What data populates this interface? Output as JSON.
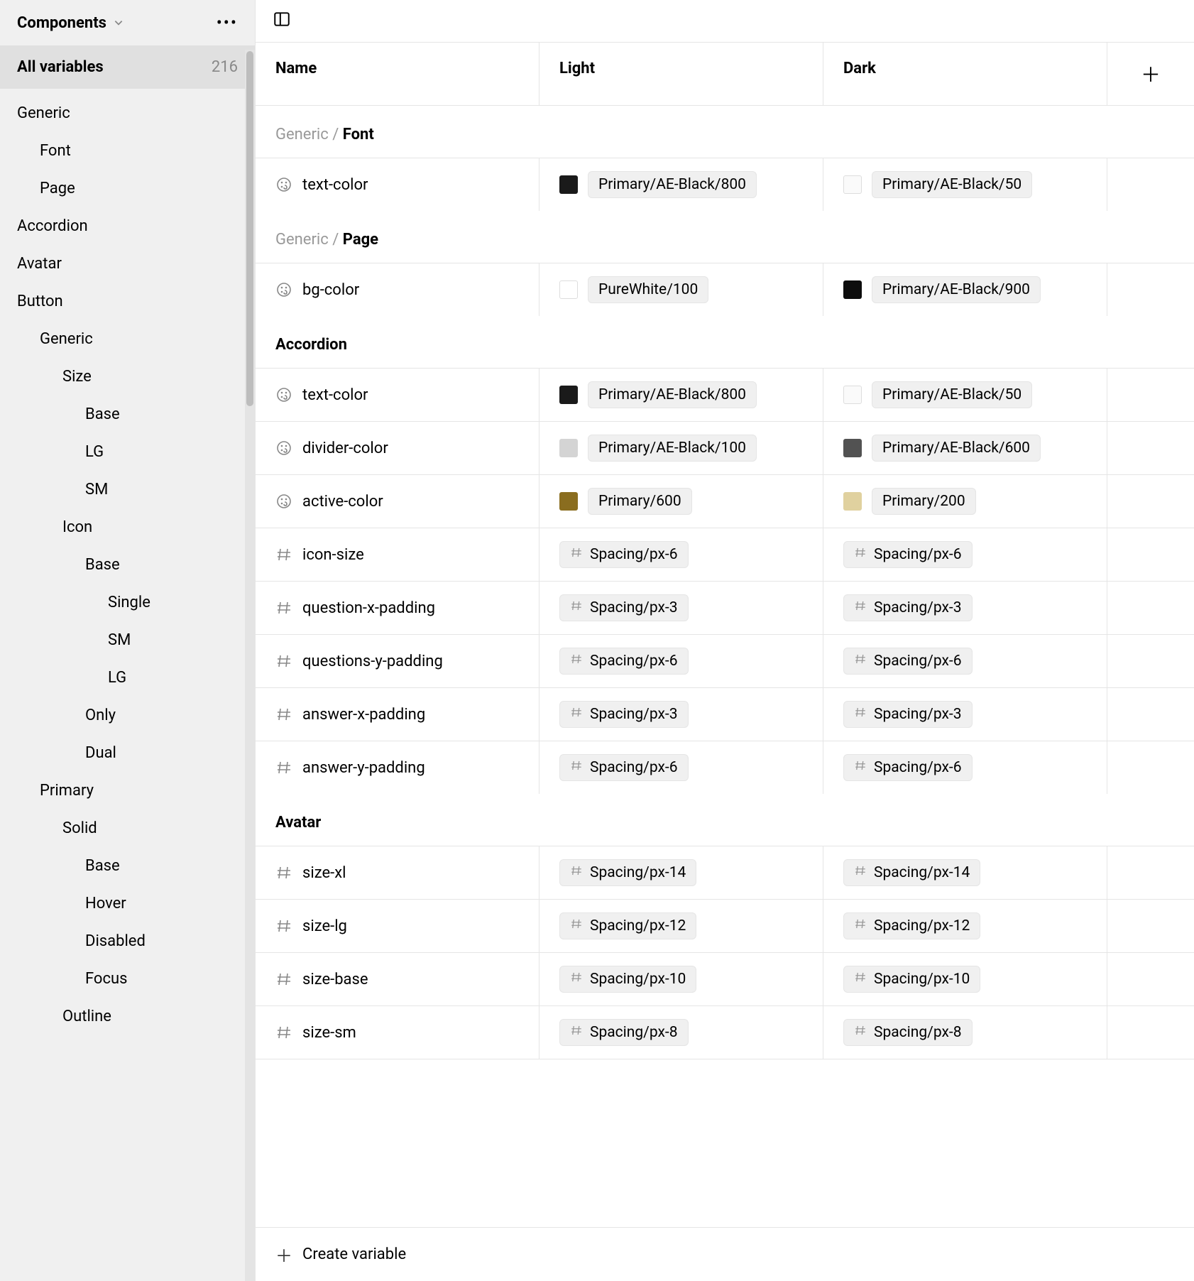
{
  "sidebar": {
    "title": "Components",
    "allVariables": {
      "label": "All variables",
      "count": "216"
    },
    "nav": [
      {
        "label": "Generic",
        "level": 1
      },
      {
        "label": "Font",
        "level": 2
      },
      {
        "label": "Page",
        "level": 2
      },
      {
        "label": "Accordion",
        "level": 1
      },
      {
        "label": "Avatar",
        "level": 1
      },
      {
        "label": "Button",
        "level": 1
      },
      {
        "label": "Generic",
        "level": 2
      },
      {
        "label": "Size",
        "level": 3
      },
      {
        "label": "Base",
        "level": 4
      },
      {
        "label": "LG",
        "level": 4
      },
      {
        "label": "SM",
        "level": 4
      },
      {
        "label": "Icon",
        "level": 3
      },
      {
        "label": "Base",
        "level": 4
      },
      {
        "label": "Single",
        "level": 5
      },
      {
        "label": "SM",
        "level": 5
      },
      {
        "label": "LG",
        "level": 5
      },
      {
        "label": "Only",
        "level": 4
      },
      {
        "label": "Dual",
        "level": 4
      },
      {
        "label": "Primary",
        "level": 2
      },
      {
        "label": "Solid",
        "level": 3
      },
      {
        "label": "Base",
        "level": 4
      },
      {
        "label": "Hover",
        "level": 4
      },
      {
        "label": "Disabled",
        "level": 4
      },
      {
        "label": "Focus",
        "level": 4
      },
      {
        "label": "Outline",
        "level": 3
      }
    ]
  },
  "table": {
    "headers": {
      "name": "Name",
      "light": "Light",
      "dark": "Dark"
    },
    "sections": [
      {
        "titleMuted": "Generic / ",
        "titleStrong": "Font",
        "rows": [
          {
            "type": "color",
            "name": "text-color",
            "light": {
              "swatch": "#1a1a1a",
              "label": "Primary/AE-Black/800"
            },
            "dark": {
              "swatch": "#fafafa",
              "outlined": true,
              "label": "Primary/AE-Black/50"
            }
          }
        ]
      },
      {
        "titleMuted": "Generic / ",
        "titleStrong": "Page",
        "rows": [
          {
            "type": "color",
            "name": "bg-color",
            "light": {
              "swatch": "#ffffff",
              "outlined": true,
              "label": "PureWhite/100"
            },
            "dark": {
              "swatch": "#0d0d0d",
              "label": "Primary/AE-Black/900"
            }
          }
        ]
      },
      {
        "titleMuted": "",
        "titleStrong": "Accordion",
        "rows": [
          {
            "type": "color",
            "name": "text-color",
            "light": {
              "swatch": "#1a1a1a",
              "label": "Primary/AE-Black/800"
            },
            "dark": {
              "swatch": "#fafafa",
              "outlined": true,
              "label": "Primary/AE-Black/50"
            }
          },
          {
            "type": "color",
            "name": "divider-color",
            "light": {
              "swatch": "#d4d4d4",
              "label": "Primary/AE-Black/100"
            },
            "dark": {
              "swatch": "#525252",
              "label": "Primary/AE-Black/600"
            }
          },
          {
            "type": "color",
            "name": "active-color",
            "light": {
              "swatch": "#8a6d1f",
              "label": "Primary/600"
            },
            "dark": {
              "swatch": "#e0d19f",
              "label": "Primary/200"
            }
          },
          {
            "type": "number",
            "name": "icon-size",
            "light": {
              "label": "Spacing/px-6"
            },
            "dark": {
              "label": "Spacing/px-6"
            }
          },
          {
            "type": "number",
            "name": "question-x-padding",
            "light": {
              "label": "Spacing/px-3"
            },
            "dark": {
              "label": "Spacing/px-3"
            }
          },
          {
            "type": "number",
            "name": "questions-y-padding",
            "light": {
              "label": "Spacing/px-6"
            },
            "dark": {
              "label": "Spacing/px-6"
            }
          },
          {
            "type": "number",
            "name": "answer-x-padding",
            "light": {
              "label": "Spacing/px-3"
            },
            "dark": {
              "label": "Spacing/px-3"
            }
          },
          {
            "type": "number",
            "name": "answer-y-padding",
            "light": {
              "label": "Spacing/px-6"
            },
            "dark": {
              "label": "Spacing/px-6"
            }
          }
        ]
      },
      {
        "titleMuted": "",
        "titleStrong": "Avatar",
        "rows": [
          {
            "type": "number",
            "name": "size-xl",
            "light": {
              "label": "Spacing/px-14"
            },
            "dark": {
              "label": "Spacing/px-14"
            }
          },
          {
            "type": "number",
            "name": "size-lg",
            "light": {
              "label": "Spacing/px-12"
            },
            "dark": {
              "label": "Spacing/px-12"
            }
          },
          {
            "type": "number",
            "name": "size-base",
            "light": {
              "label": "Spacing/px-10"
            },
            "dark": {
              "label": "Spacing/px-10"
            }
          },
          {
            "type": "number",
            "name": "size-sm",
            "light": {
              "label": "Spacing/px-8"
            },
            "dark": {
              "label": "Spacing/px-8"
            }
          }
        ]
      }
    ]
  },
  "footer": {
    "createVariable": "Create variable"
  }
}
